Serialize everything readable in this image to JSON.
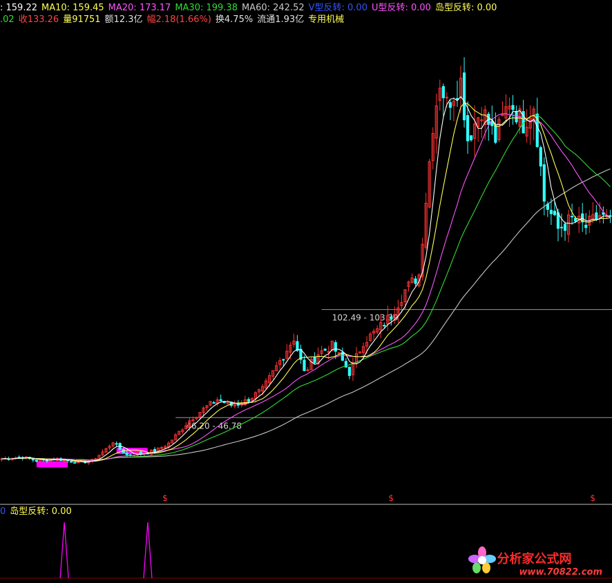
{
  "header": {
    "ma": [
      {
        "label": ": 159.22",
        "color": "#ffffff"
      },
      {
        "label": "MA10: 159.45",
        "color": "#ffff55"
      },
      {
        "label": "MA20: 173.17",
        "color": "#ff55ff"
      },
      {
        "label": "MA30: 199.38",
        "color": "#33dd33"
      },
      {
        "label": "MA60: 242.52",
        "color": "#c8c8c8"
      },
      {
        "label": "V型反转: 0.00",
        "color": "#3355ff"
      },
      {
        "label": "U型反转: 0.00",
        "color": "#ff55ff"
      },
      {
        "label": "岛型反转: 0.00",
        "color": "#ffff55"
      }
    ],
    "quote": [
      {
        "label": ".02",
        "color": "#33dd33"
      },
      {
        "label": "收133.26",
        "color": "#ff4444"
      },
      {
        "label": "量91751",
        "color": "#ffff55"
      },
      {
        "label": "额12.3亿",
        "color": "#e0e0e0"
      },
      {
        "label": "幅2.18(1.66%)",
        "color": "#ff4444"
      },
      {
        "label": "换4.75%",
        "color": "#e0e0e0"
      },
      {
        "label": "流通1.93亿",
        "color": "#e0e0e0"
      },
      {
        "label": "专用机械",
        "color": "#ffff55"
      }
    ]
  },
  "levels": [
    {
      "label": "102.49 - 103.39",
      "value": 102.9
    },
    {
      "label": "46.20 - 46.78",
      "value": 46.5
    }
  ],
  "markers": [
    "$",
    "$",
    "$"
  ],
  "indicator": {
    "prefix": "0",
    "label": "岛型反转: 0.00",
    "prefix_color": "#3355ff",
    "label_color": "#ffff55"
  },
  "watermark": {
    "title": "分析家公式网",
    "url": "www.70822.com"
  },
  "chart_data": {
    "type": "candlestick",
    "ylim": [
      16,
      250
    ],
    "colors": {
      "up": "#ff3333",
      "down": "#33ffff",
      "ma5": "#ffffff",
      "ma10": "#ffff55",
      "ma20": "#ff55ff",
      "ma30": "#33dd33",
      "ma60": "#c8c8c8",
      "zone": "#ff00ff",
      "signal": "#ff00ff"
    },
    "candles_count": 176,
    "keyframes_close": [
      [
        0,
        25
      ],
      [
        6,
        26
      ],
      [
        10,
        24
      ],
      [
        16,
        25
      ],
      [
        22,
        23
      ],
      [
        26,
        24
      ],
      [
        30,
        30
      ],
      [
        32,
        34
      ],
      [
        34,
        30
      ],
      [
        36,
        27
      ],
      [
        44,
        29
      ],
      [
        48,
        33
      ],
      [
        54,
        45
      ],
      [
        58,
        51
      ],
      [
        62,
        56
      ],
      [
        66,
        53
      ],
      [
        70,
        55
      ],
      [
        75,
        61
      ],
      [
        80,
        76
      ],
      [
        84,
        88
      ],
      [
        87,
        70
      ],
      [
        91,
        80
      ],
      [
        95,
        84
      ],
      [
        98,
        76
      ],
      [
        100,
        70
      ],
      [
        104,
        86
      ],
      [
        108,
        92
      ],
      [
        112,
        100
      ],
      [
        116,
        113
      ],
      [
        120,
        121
      ],
      [
        124,
        200
      ],
      [
        126,
        222
      ],
      [
        128,
        210
      ],
      [
        132,
        222
      ],
      [
        134,
        192
      ],
      [
        138,
        208
      ],
      [
        142,
        192
      ],
      [
        146,
        212
      ],
      [
        150,
        200
      ],
      [
        153,
        210
      ],
      [
        156,
        160
      ],
      [
        160,
        145
      ],
      [
        164,
        150
      ],
      [
        168,
        146
      ],
      [
        172,
        152
      ],
      [
        175,
        148
      ]
    ],
    "zones": [
      {
        "start": 10,
        "end": 19,
        "value": 23
      },
      {
        "start": 33,
        "end": 42,
        "value": 30
      }
    ],
    "signals": [
      18,
      42
    ],
    "marker_index": [
      47,
      112,
      170
    ]
  }
}
